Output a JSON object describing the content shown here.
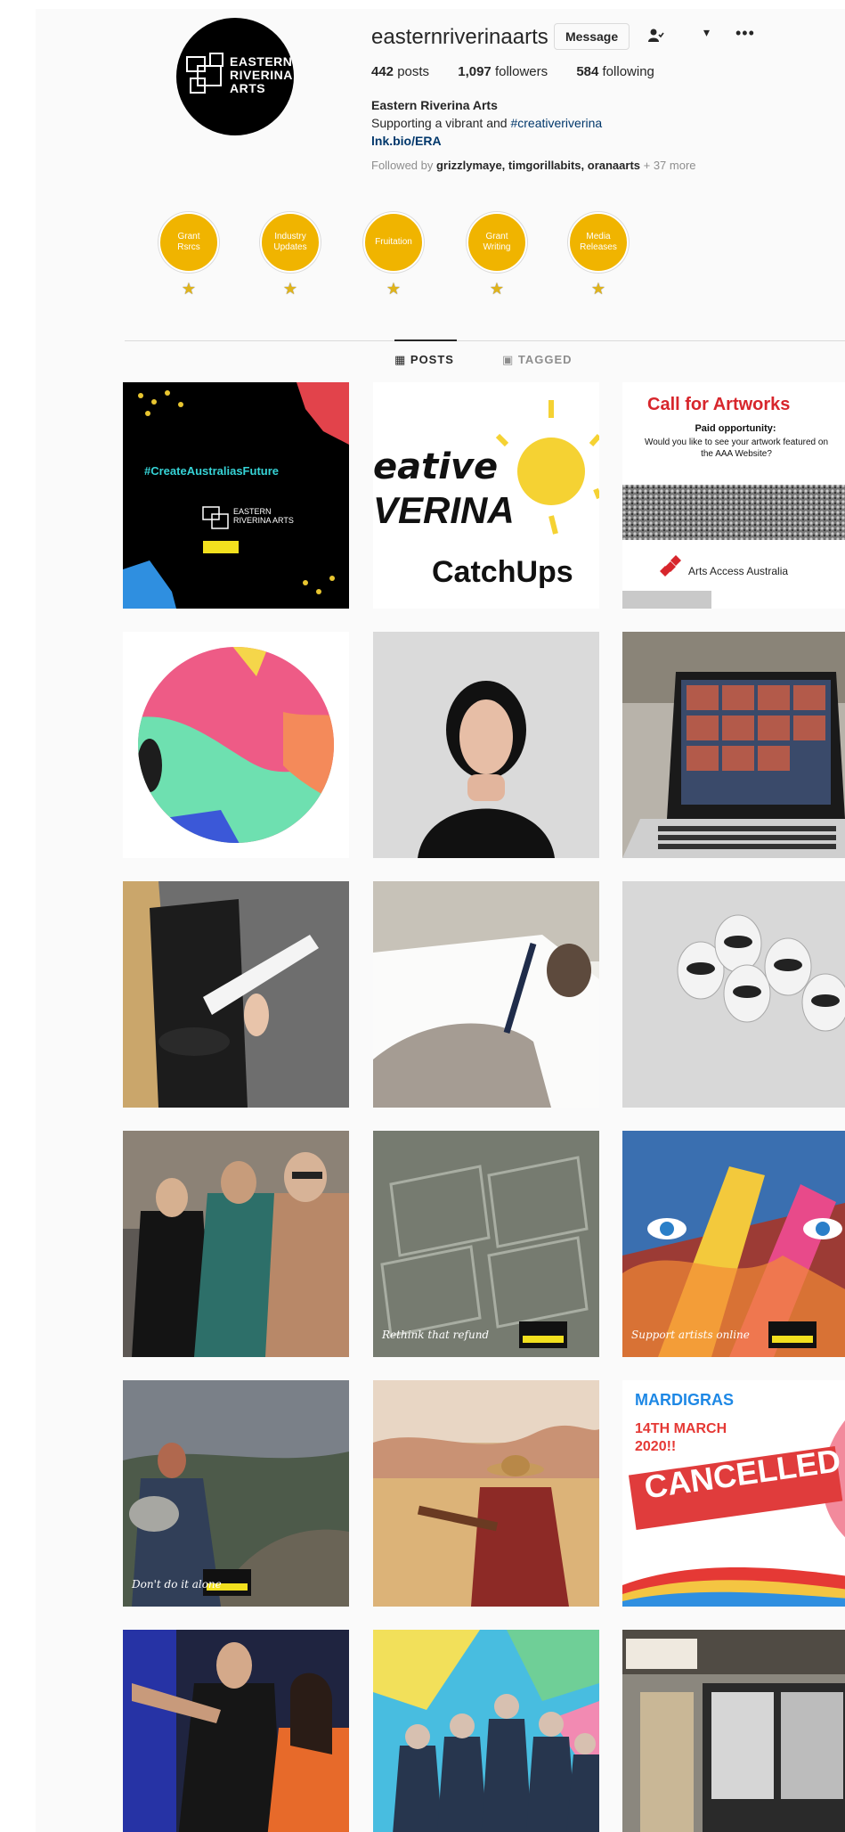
{
  "profile": {
    "username": "easternriverinaarts",
    "avatar_text": "EASTERN\nRIVERINA\nARTS",
    "message_label": "Message",
    "follow_icon": "person-check-icon",
    "dropdown_icon": "chevron-down-icon",
    "more_icon": "more-horizontal-icon",
    "posts": "442",
    "posts_label": "posts",
    "followers": "1,097",
    "followers_label": "followers",
    "following": "584",
    "following_label": "following",
    "name": "Eastern Riverina Arts",
    "bio_text": "Supporting a vibrant and ",
    "bio_hashtag": "#creativeriverina",
    "link": "lnk.bio/ERA",
    "followed_prefix": "Followed by ",
    "followed_names": "grizzlymaye, timgorillabits, oranaarts",
    "followed_more": " + 37 more"
  },
  "highlights": [
    {
      "label": "Grant Rsrcs"
    },
    {
      "label": "Industry Updates"
    },
    {
      "label": "Fruitation"
    },
    {
      "label": "Grant Writing"
    },
    {
      "label": "Media Releases"
    }
  ],
  "tabs": {
    "posts": "▦ POSTS",
    "tagged": "▣ TAGGED"
  },
  "posts": {
    "p1_text": "#CreateAustraliasFuture",
    "p1_logo": "EASTERN RIVERINA ARTS",
    "p2_line1": "eative",
    "p2_line2": "VERINA",
    "p2_line3": "CatchUps",
    "p3_title": "Call for Artworks",
    "p3_sub": "Paid opportunity:",
    "p3_body": "Would you like to see your artwork featured on the AAA Website?",
    "p3_footer": "Arts Access Australia",
    "p11_caption": "Rethink that refund",
    "p12_caption": "Support artists online",
    "p13_caption": "Don't do it alone",
    "p15_line1": "MARDIGRAS",
    "p15_line2": "14TH MARCH",
    "p15_line3": "2020!!",
    "p15_stamp": "CANCELLED",
    "brand_badge": "Creative RIVERINA",
    "colors": {
      "highlight": "#f0b400",
      "link": "#00376b",
      "call_red": "#d7262c"
    }
  }
}
